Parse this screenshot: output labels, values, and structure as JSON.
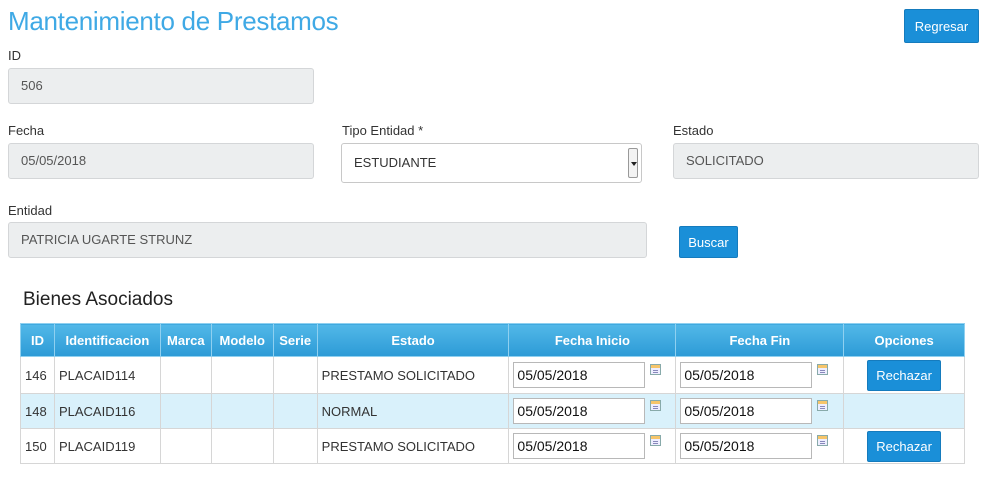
{
  "page": {
    "title": "Mantenimiento de Prestamos",
    "back_button": "Regresar"
  },
  "form": {
    "id_label": "ID",
    "id_value": "506",
    "fecha_label": "Fecha",
    "fecha_value": "05/05/2018",
    "tipo_entidad_label": "Tipo Entidad *",
    "tipo_entidad_value": "ESTUDIANTE",
    "estado_label": "Estado",
    "estado_value": "SOLICITADO",
    "entidad_label": "Entidad",
    "entidad_value": "PATRICIA  UGARTE STRUNZ",
    "buscar_button": "Buscar"
  },
  "bienes": {
    "title": "Bienes Asociados",
    "columns": [
      "ID",
      "Identificacion",
      "Marca",
      "Modelo",
      "Serie",
      "Estado",
      "Fecha Inicio",
      "Fecha Fin",
      "Opciones"
    ],
    "rows": [
      {
        "id": "146",
        "identificacion": "PLACAID114",
        "marca": "",
        "modelo": "",
        "serie": "",
        "estado": "PRESTAMO SOLICITADO",
        "fecha_inicio": "05/05/2018",
        "fecha_fin": "05/05/2018",
        "opcion": "Rechazar"
      },
      {
        "id": "148",
        "identificacion": "PLACAID116",
        "marca": "",
        "modelo": "",
        "serie": "",
        "estado": "NORMAL",
        "fecha_inicio": "05/05/2018",
        "fecha_fin": "05/05/2018",
        "opcion": ""
      },
      {
        "id": "150",
        "identificacion": "PLACAID119",
        "marca": "",
        "modelo": "",
        "serie": "",
        "estado": "PRESTAMO SOLICITADO",
        "fecha_inicio": "05/05/2018",
        "fecha_fin": "05/05/2018",
        "opcion": "Rechazar"
      }
    ]
  },
  "colors": {
    "accent": "#1a8fd8",
    "title": "#3fa9e5",
    "header": "#2c9ad6",
    "alt_row": "#d9f1fb"
  },
  "icons": {
    "calendar": "calendar-icon",
    "dropdown": "chevron-down-icon"
  }
}
